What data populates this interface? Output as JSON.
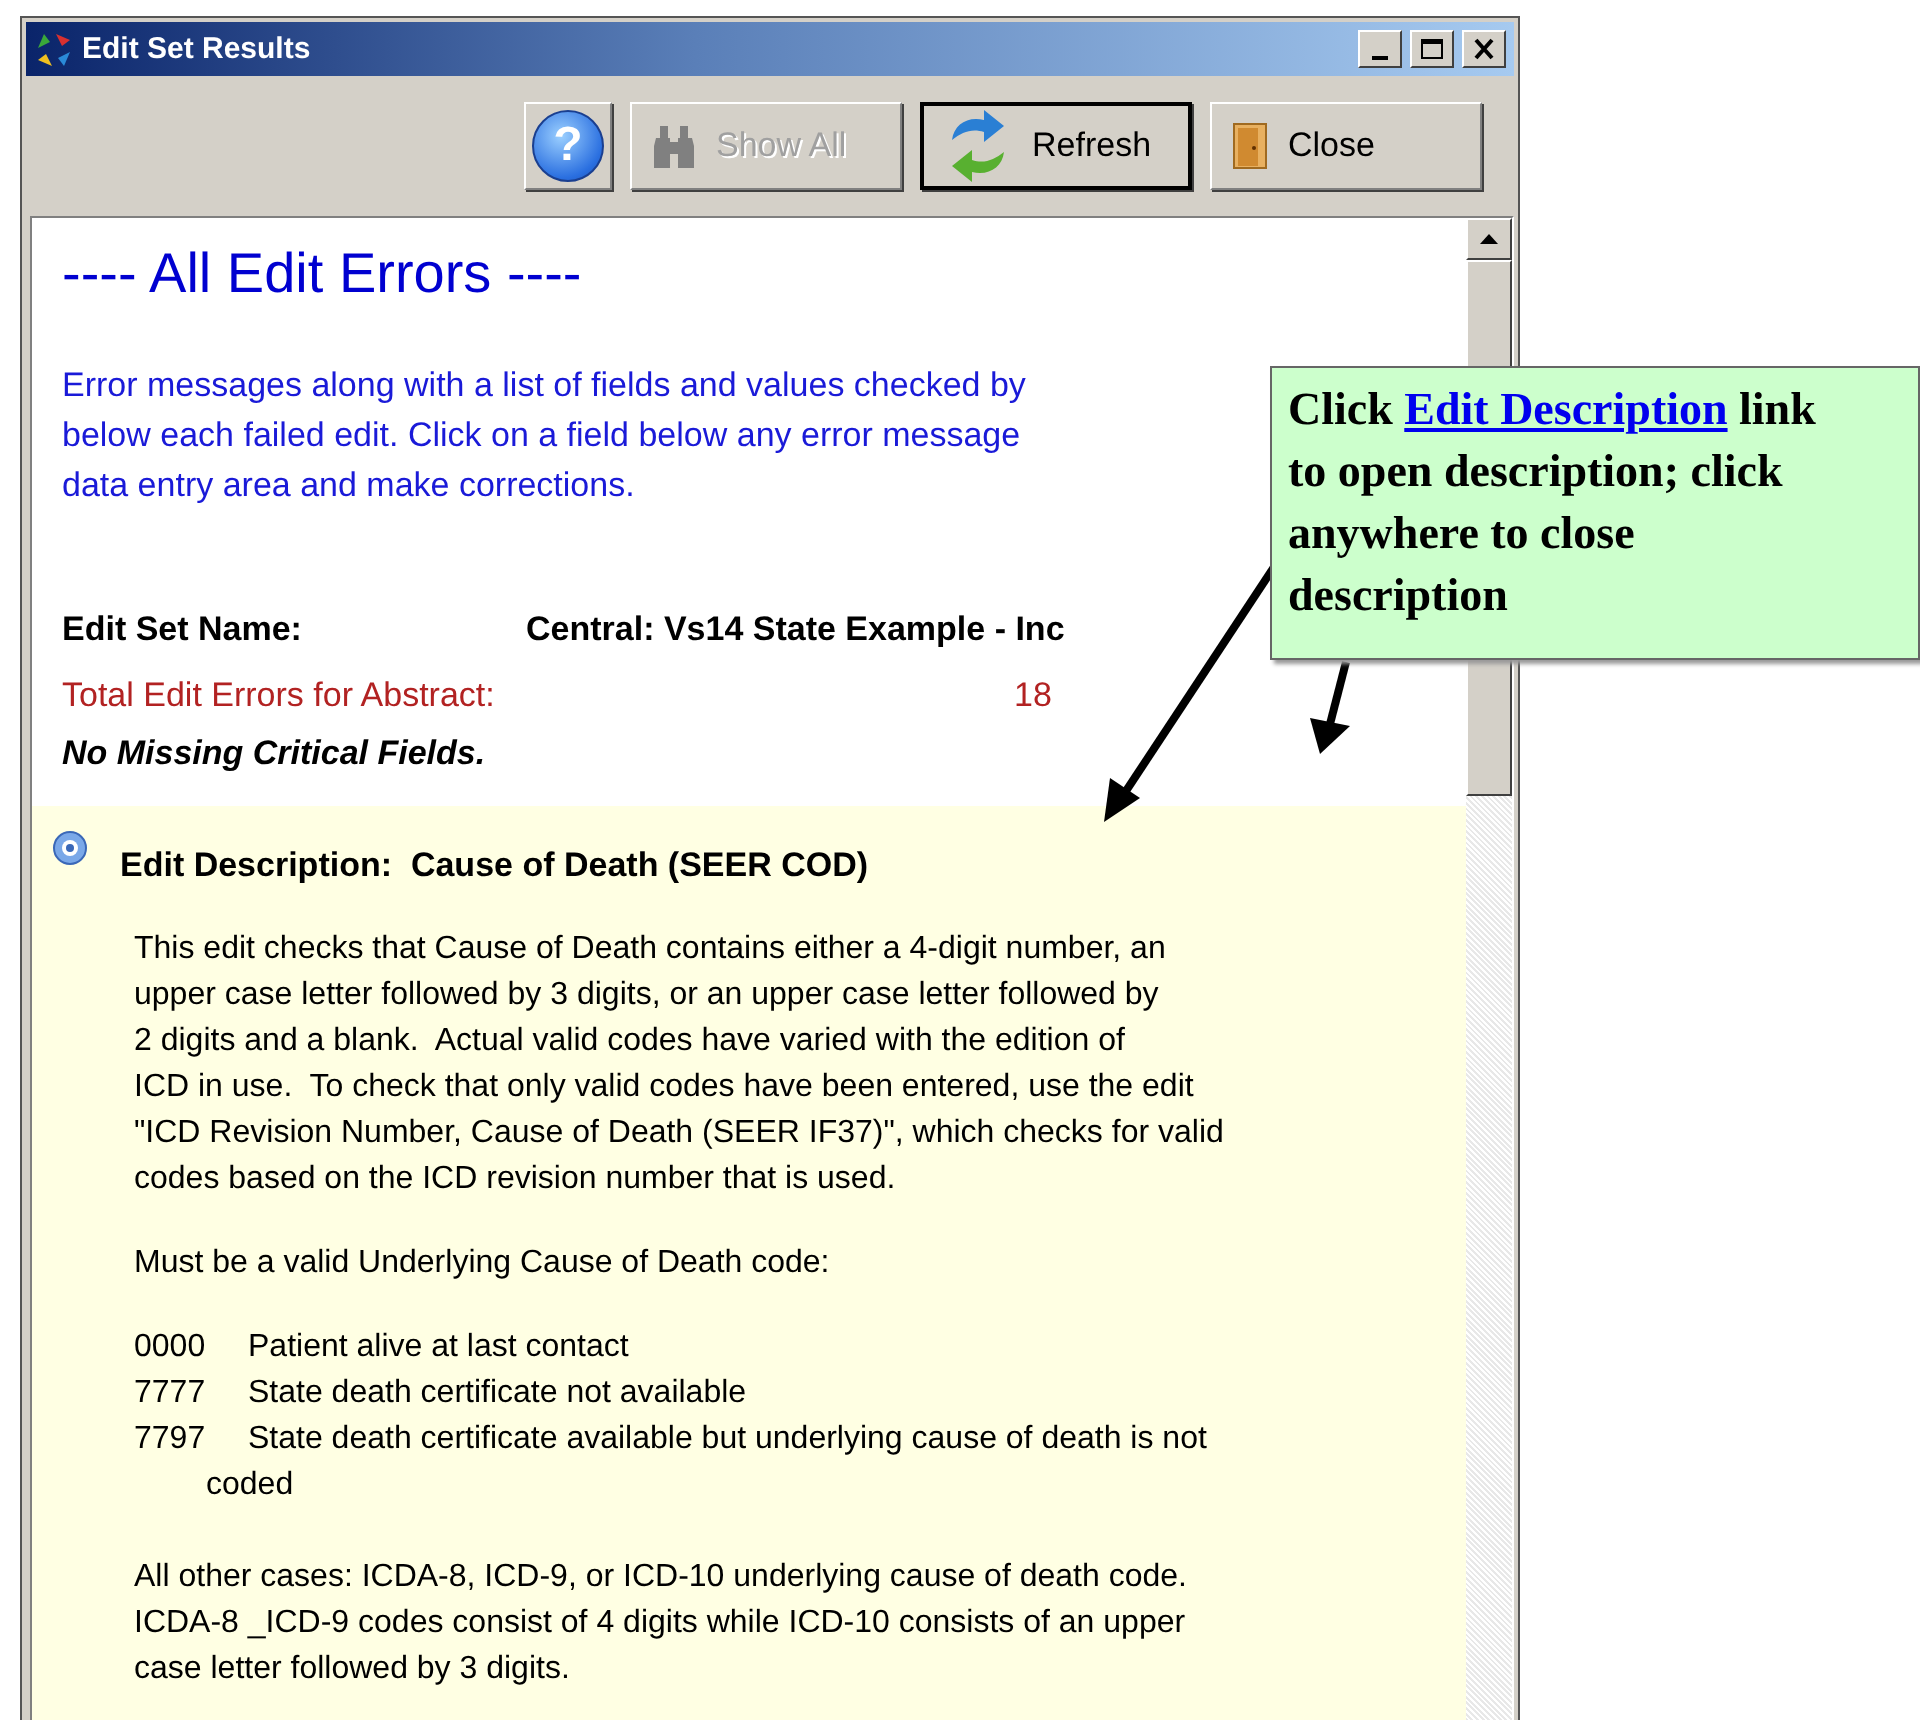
{
  "window": {
    "title": "Edit Set Results"
  },
  "toolbar": {
    "buttons": [
      {
        "kind": "help",
        "label": "?",
        "disabled": false,
        "focused": false
      },
      {
        "kind": "show-all",
        "label": "Show All",
        "disabled": true,
        "focused": false
      },
      {
        "kind": "refresh",
        "label": "Refresh",
        "disabled": false,
        "focused": true
      },
      {
        "kind": "close",
        "label": "Close",
        "disabled": false,
        "focused": false
      }
    ]
  },
  "report": {
    "heading": "---- All Edit Errors ----",
    "intro_lines": [
      "Error messages along with a list of fields and values checked by",
      "below each failed edit.  Click on a field below any error message",
      "data entry area and make corrections."
    ],
    "edit_set": {
      "label": "Edit Set Name:",
      "value": "Central: Vs14 State Example - Inc"
    },
    "total_errors": {
      "label": "Total Edit Errors for Abstract:",
      "value": "18"
    },
    "critical_fields_note": "No Missing Critical Fields."
  },
  "description_popup": {
    "title": "Edit Description:  Cause of Death (SEER COD)",
    "paragraph": "This edit checks that Cause of Death contains either a 4-digit number, an\nupper case letter followed by 3 digits, or an upper case letter followed by\n2 digits and a blank.  Actual valid codes have varied with the edition of\nICD in use.  To check that only valid codes have been entered, use the edit\n\"ICD Revision Number, Cause of Death (SEER IF37)\", which checks for valid\ncodes based on the ICD revision number that is used.",
    "rule": "Must be a valid Underlying Cause of Death code:",
    "codes": [
      {
        "code": "0000",
        "text": "Patient alive at last contact"
      },
      {
        "code": "7777",
        "text": "State death certificate not available"
      },
      {
        "code": "7797",
        "text": "State death certificate available but underlying cause of death is not coded"
      }
    ],
    "other_cases": "All other cases: ICDA-8, ICD-9, or ICD-10 underlying cause of death code.\nICDA-8 _ICD-9 codes consist of 4 digits while ICD-10 consists of an upper\ncase letter followed by 3 digits."
  },
  "callout": {
    "before": "Click",
    "link": "Edit Description",
    "after": "link to open description; click anywhere to close description"
  }
}
